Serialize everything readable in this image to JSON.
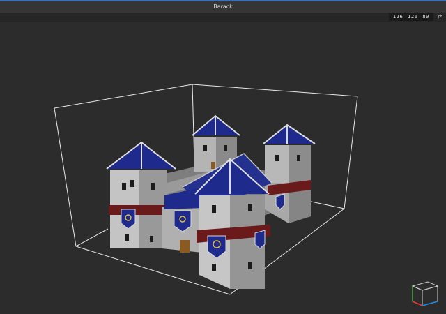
{
  "window": {
    "title": "Barack"
  },
  "toolbar": {
    "dimensions": "126 126 80",
    "swap_icon": "swap-arrows-icon"
  },
  "viewport": {
    "model_icon": "voxel-castle-model",
    "orientation_icon": "orientation-cube-icon"
  },
  "colors": {
    "accent": "#3e6fb0",
    "roof": "#1f2b8c",
    "wall": "#c9c9c9",
    "banner": "#6a1a1a",
    "background": "#2c2c2c"
  }
}
